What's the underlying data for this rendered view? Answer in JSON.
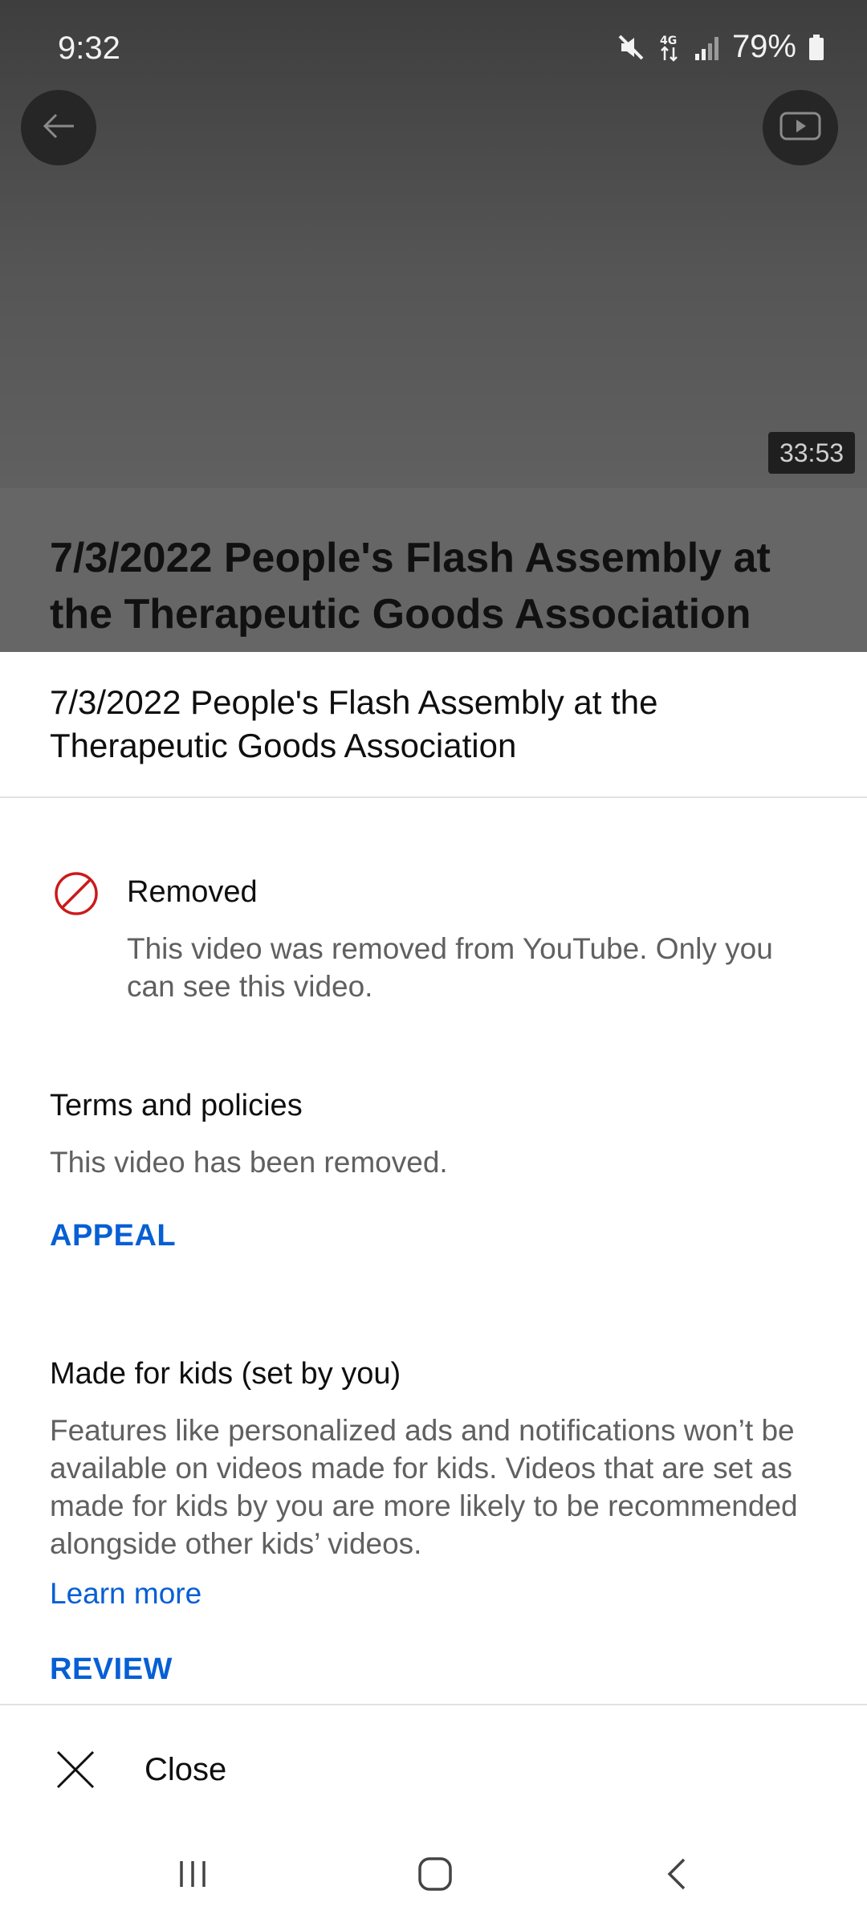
{
  "status_bar": {
    "time": "9:32",
    "battery": "79%",
    "network": "4G"
  },
  "video": {
    "duration": "33:53",
    "title": "7/3/2022 People's Flash Assembly at the Therapeutic Goods Association"
  },
  "sheet": {
    "title": "7/3/2022 People's Flash Assembly at the Therapeutic Goods Association",
    "removed": {
      "label": "Removed",
      "description": "This video was removed from YouTube. Only you can see this video."
    },
    "terms": {
      "heading": "Terms and policies",
      "text": "This video has been removed.",
      "action": "APPEAL"
    },
    "kids": {
      "heading": "Made for kids (set by you)",
      "text": "Features like personalized ads and notifications won’t be available on videos made for kids. Videos that are set as made for kids by you are more likely to be recommended alongside other kids’ videos.",
      "link": "Learn more",
      "action": "REVIEW"
    },
    "close_label": "Close"
  },
  "colors": {
    "accent": "#065fd4",
    "removed_icon": "#cc1a1a",
    "secondary_text": "#606060"
  },
  "icons": {
    "back": "arrow-left-icon",
    "youtube": "youtube-play-icon",
    "removed": "prohibited-icon",
    "close": "close-icon",
    "nav_recent": "recent-apps-icon",
    "nav_home": "home-icon",
    "nav_back": "chevron-left-icon"
  }
}
